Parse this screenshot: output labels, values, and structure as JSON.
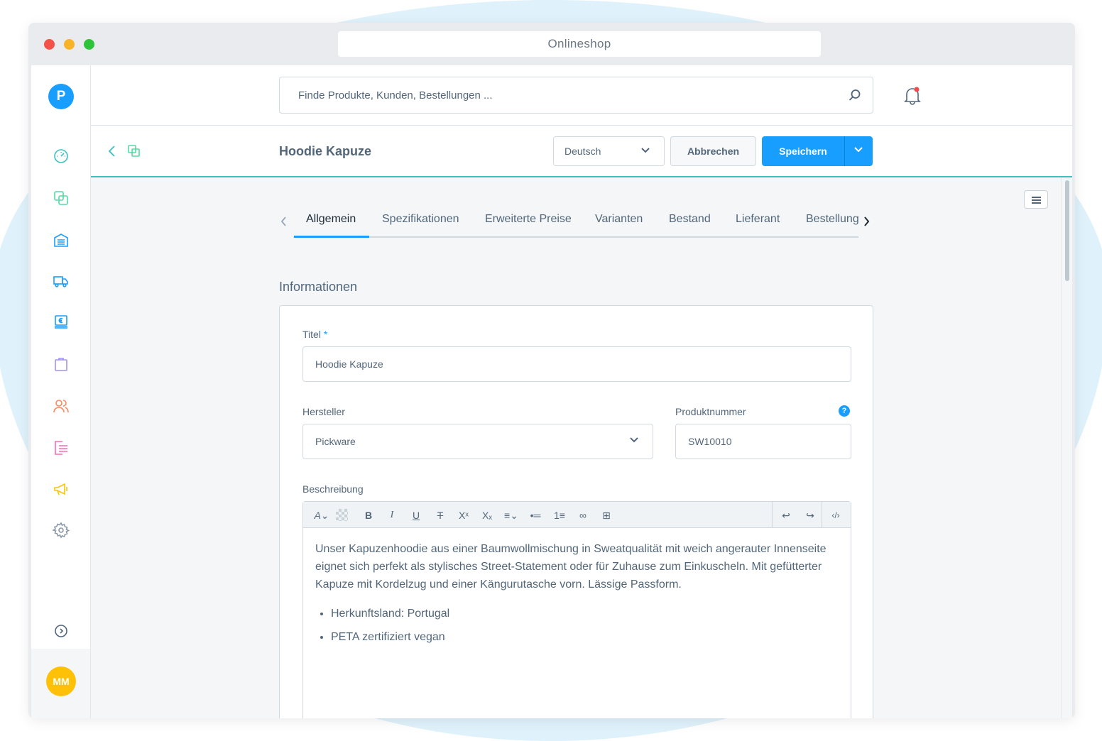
{
  "window": {
    "url_title": "Onlineshop"
  },
  "sidebar": {
    "logo_letter": "P",
    "items": [
      {
        "name": "dashboard",
        "icon": "speedometer-icon",
        "color": "#3cc1c0"
      },
      {
        "name": "catalogues",
        "icon": "copy-icon",
        "color": "#57d9a3"
      },
      {
        "name": "warehouse",
        "icon": "warehouse-icon",
        "color": "#189eff"
      },
      {
        "name": "shipping",
        "icon": "truck-icon",
        "color": "#189eff"
      },
      {
        "name": "payment",
        "icon": "euro-register-icon",
        "color": "#189eff"
      },
      {
        "name": "orders",
        "icon": "shopping-bag-icon",
        "color": "#a092f0"
      },
      {
        "name": "customers",
        "icon": "users-icon",
        "color": "#f88962"
      },
      {
        "name": "content",
        "icon": "list-icon",
        "color": "#ff68b4"
      },
      {
        "name": "marketing",
        "icon": "megaphone-icon",
        "color": "#ffd700"
      },
      {
        "name": "settings",
        "icon": "gear-icon",
        "color": "#9aa8b5"
      }
    ],
    "user_initials": "MM"
  },
  "search": {
    "placeholder": "Finde Produkte, Kunden, Bestellungen ..."
  },
  "smartbar": {
    "title": "Hoodie Kapuze",
    "language": "Deutsch",
    "cancel_label": "Abbrechen",
    "save_label": "Speichern"
  },
  "tabs": [
    "Allgemein",
    "Spezifikationen",
    "Erweiterte Preise",
    "Varianten",
    "Bestand",
    "Lieferant",
    "Bestellung"
  ],
  "section_title": "Informationen",
  "form": {
    "title_label": "Titel",
    "title_required": "*",
    "title_value": "Hoodie Kapuze",
    "manufacturer_label": "Hersteller",
    "manufacturer_value": "Pickware",
    "product_number_label": "Produktnummer",
    "product_number_value": "SW10010",
    "help_symbol": "?",
    "description_label": "Beschreibung",
    "description_text": "Unser Kapuzenhoodie aus einer Baumwollmischung in Sweatqualität mit weich angerauter Innenseite eignet sich perfekt als stylisches Street-Statement oder für Zuhause zum Einkuscheln. Mit gefütterter Kapuze mit Kordelzug und einer Kängurutasche vorn. Lässige Passform.",
    "description_bullets": [
      "Herkunftsland: Portugal",
      "PETA zertifiziert vegan"
    ]
  },
  "colors": {
    "primary": "#189eff",
    "accent_line": "#3cc1c0",
    "text": "#52667a"
  }
}
